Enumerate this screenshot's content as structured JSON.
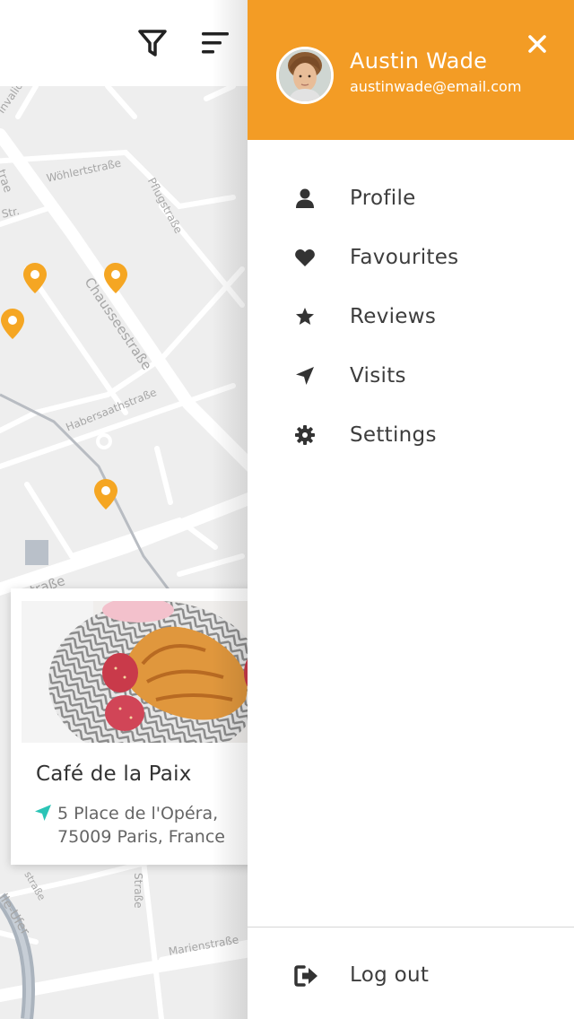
{
  "toolbar": {
    "filter_icon": "filter-icon",
    "sort_icon": "sort-lines-icon"
  },
  "map": {
    "streets": [
      "Invalidenstra",
      "Wöhlertstraße",
      "Pflugstraße",
      "Chausseestraße",
      "Habersaathstraße",
      "traße",
      "lle-Ufer",
      "Straße",
      "Marienstraße",
      "straße",
      "Str.",
      "trae"
    ],
    "pin_color": "#f5a623"
  },
  "place_card": {
    "title": "Café de la Paix",
    "address_line1": "5 Place de l'Opéra,",
    "address_line2": "75009 Paris, France",
    "pin_icon_color": "#2bc4b6"
  },
  "drawer": {
    "header_color": "#f39c25",
    "user_name": "Austin Wade",
    "user_email": "austinwade@email.com",
    "close_icon": "close-icon",
    "menu": [
      {
        "label": "Profile",
        "icon": "user-icon"
      },
      {
        "label": "Favourites",
        "icon": "heart-icon"
      },
      {
        "label": "Reviews",
        "icon": "star-icon"
      },
      {
        "label": "Visits",
        "icon": "location-arrow-icon"
      },
      {
        "label": "Settings",
        "icon": "gear-icon"
      }
    ],
    "logout_label": "Log out"
  }
}
